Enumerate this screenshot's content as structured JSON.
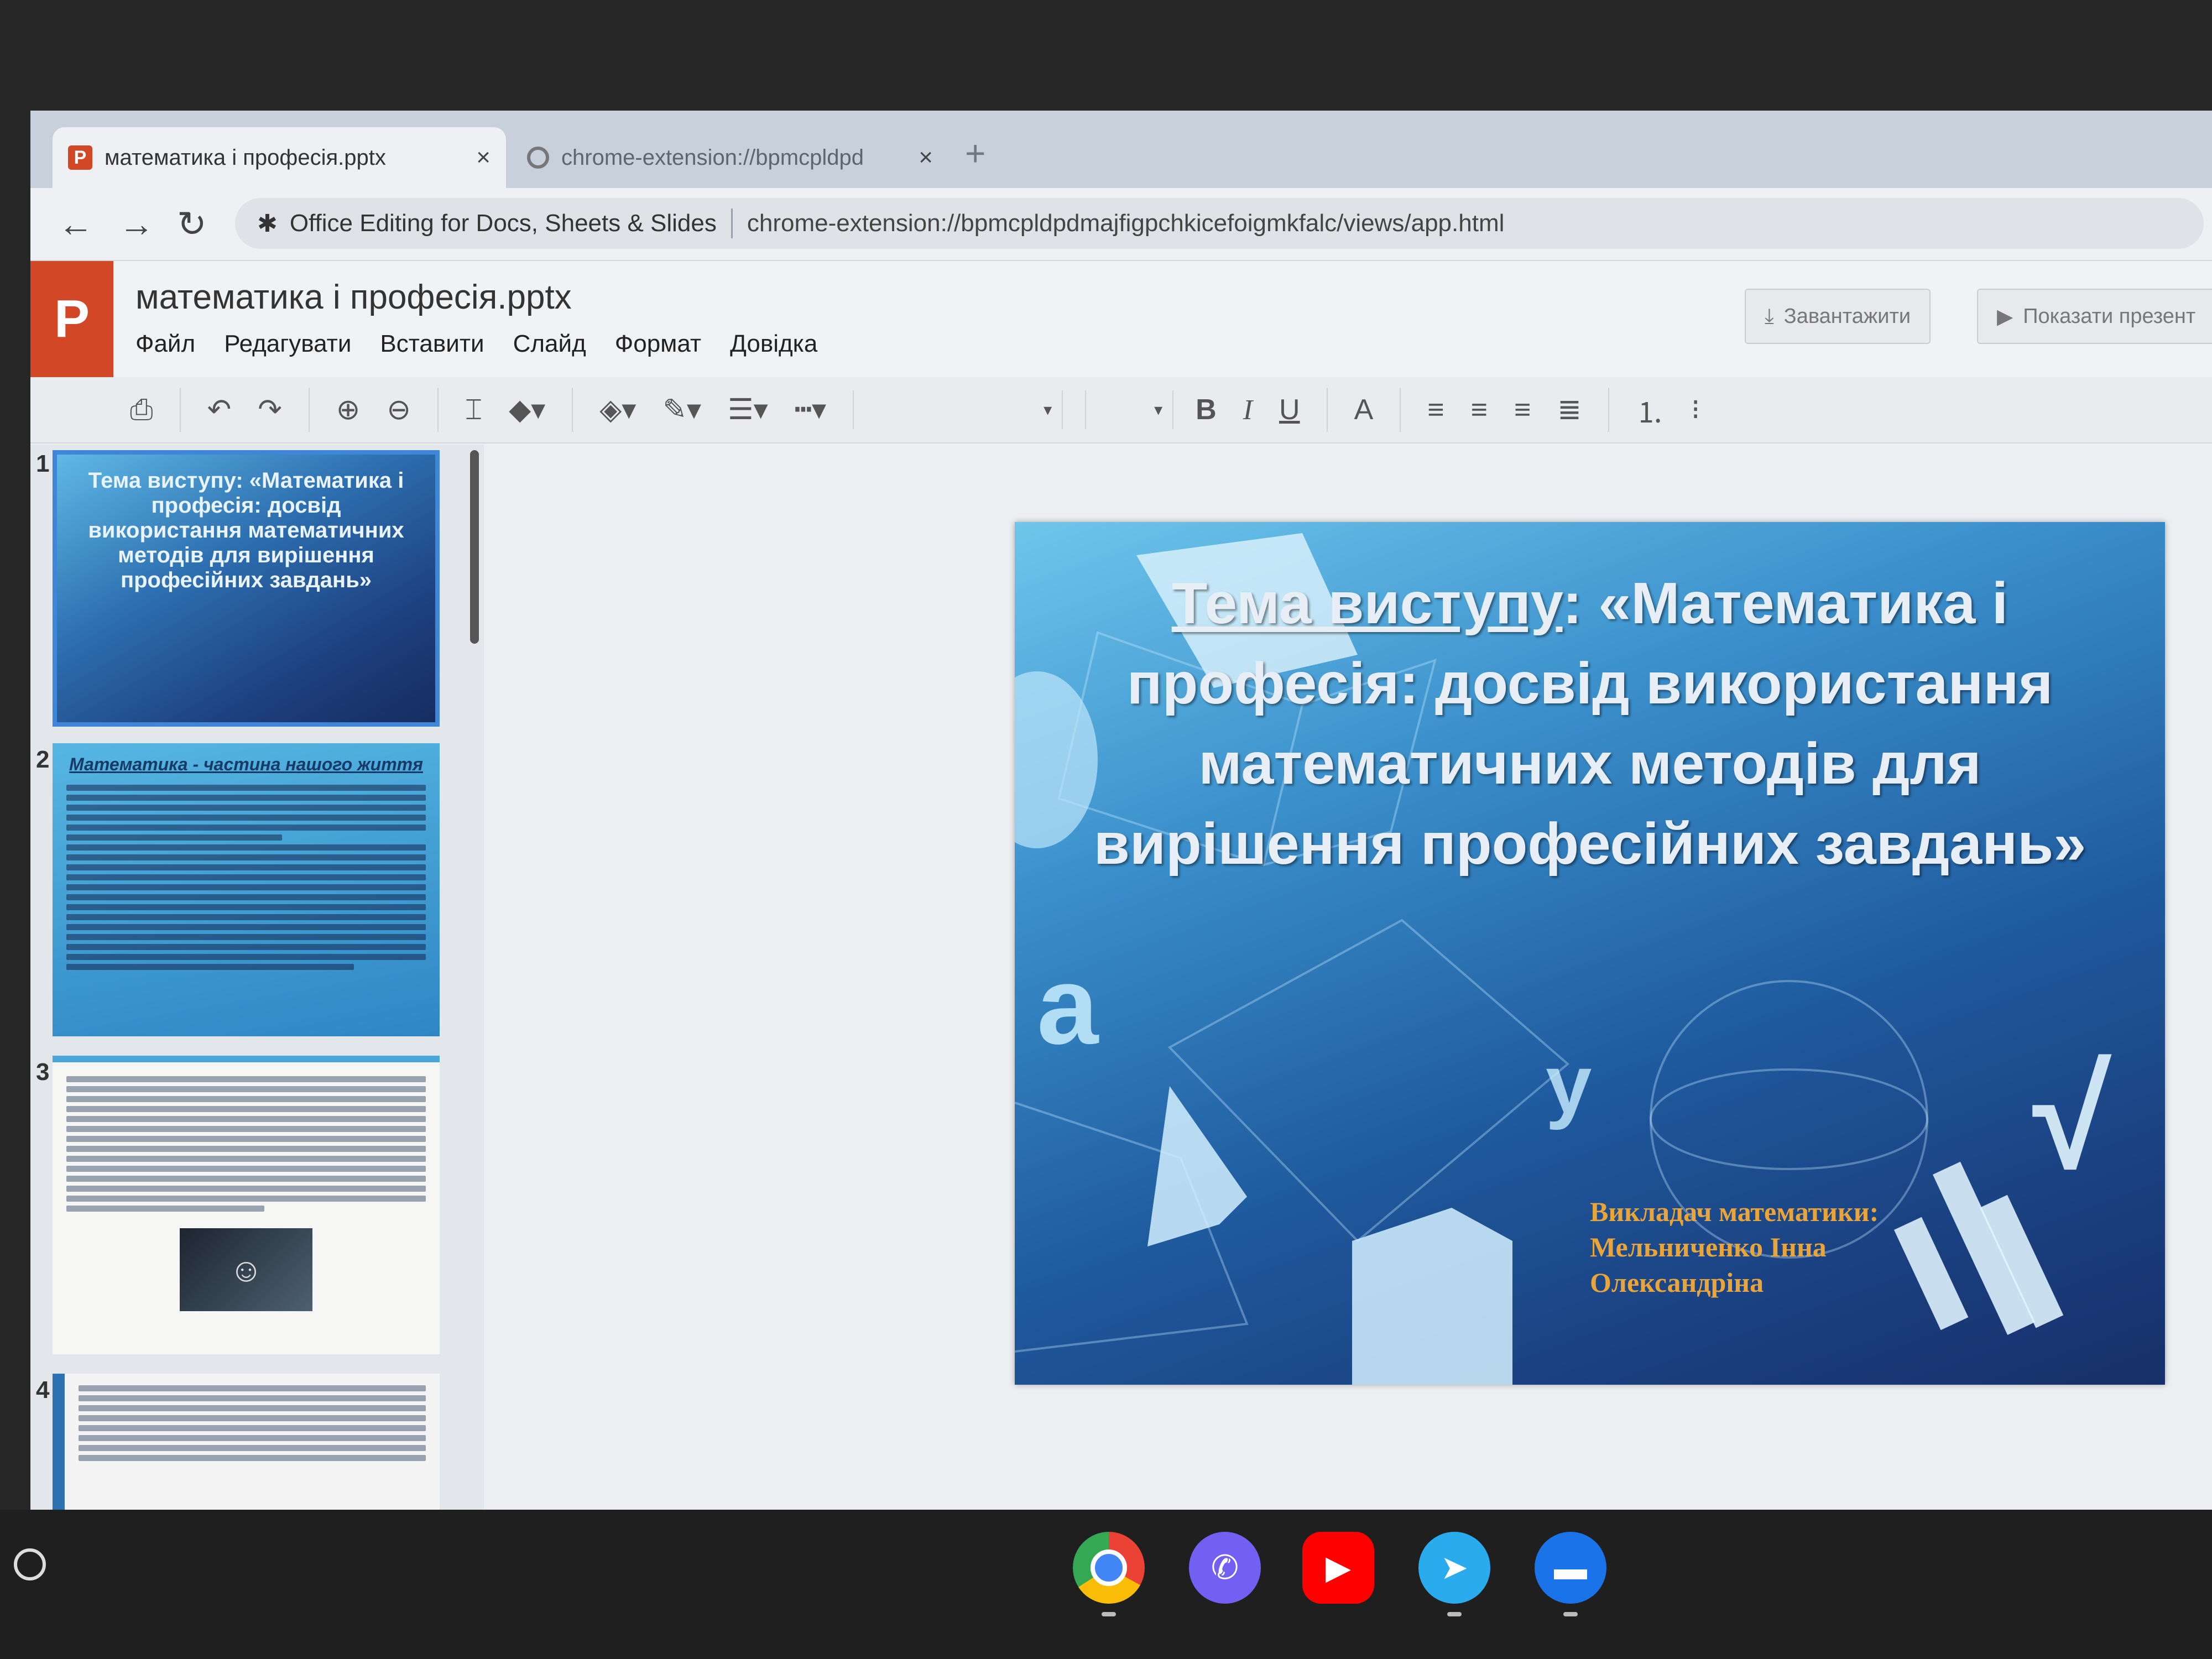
{
  "browser": {
    "tabs": [
      {
        "title": "математика і професія.pptx",
        "close": "×",
        "active": true,
        "icon": "powerpoint-icon"
      },
      {
        "title": "chrome-extension://bpmcpldpd",
        "close": "×",
        "active": false,
        "icon": "extension-icon"
      }
    ],
    "new_tab": "+",
    "nav": {
      "back": "←",
      "forward": "→",
      "reload": "↻"
    },
    "omnibox": {
      "extension_name": "Office Editing for Docs, Sheets & Slides",
      "url": "chrome-extension://bpmcpldpdmajfigpchkicefoigmkfalc/views/app.html"
    }
  },
  "app": {
    "logo": "P",
    "doc_title": "математика і професія.pptx",
    "menu": [
      "Файл",
      "Редагувати",
      "Вставити",
      "Слайд",
      "Формат",
      "Довідка"
    ],
    "download_label": "Завантажити",
    "present_label": "Показати презент"
  },
  "toolbar": {
    "bold": "B",
    "italic": "I",
    "underline": "U",
    "font_color": "A"
  },
  "thumbnails": {
    "numbers": [
      "1",
      "2",
      "3",
      "4"
    ],
    "slide1_text": "Тема виступу: «Математика і професія: досвід використання математичних методів для вирішення професійних завдань»",
    "slide2_title": "Математика - частина нашого життя"
  },
  "slide": {
    "title_prefix": "Тема виступу",
    "title_rest": ": «Математика і професія: досвід використання математичних методів для вирішення професійних завдань»",
    "presenter_line1": "Викладач математики:",
    "presenter_line2": "Мельниченко Інна",
    "presenter_line3": "Олександріна",
    "symbol_a": "a",
    "symbol_y": "y",
    "symbol_root": "√"
  },
  "shelf": {
    "apps": [
      "chrome-icon",
      "viber-icon",
      "youtube-icon",
      "telegram-icon",
      "files-icon"
    ]
  }
}
